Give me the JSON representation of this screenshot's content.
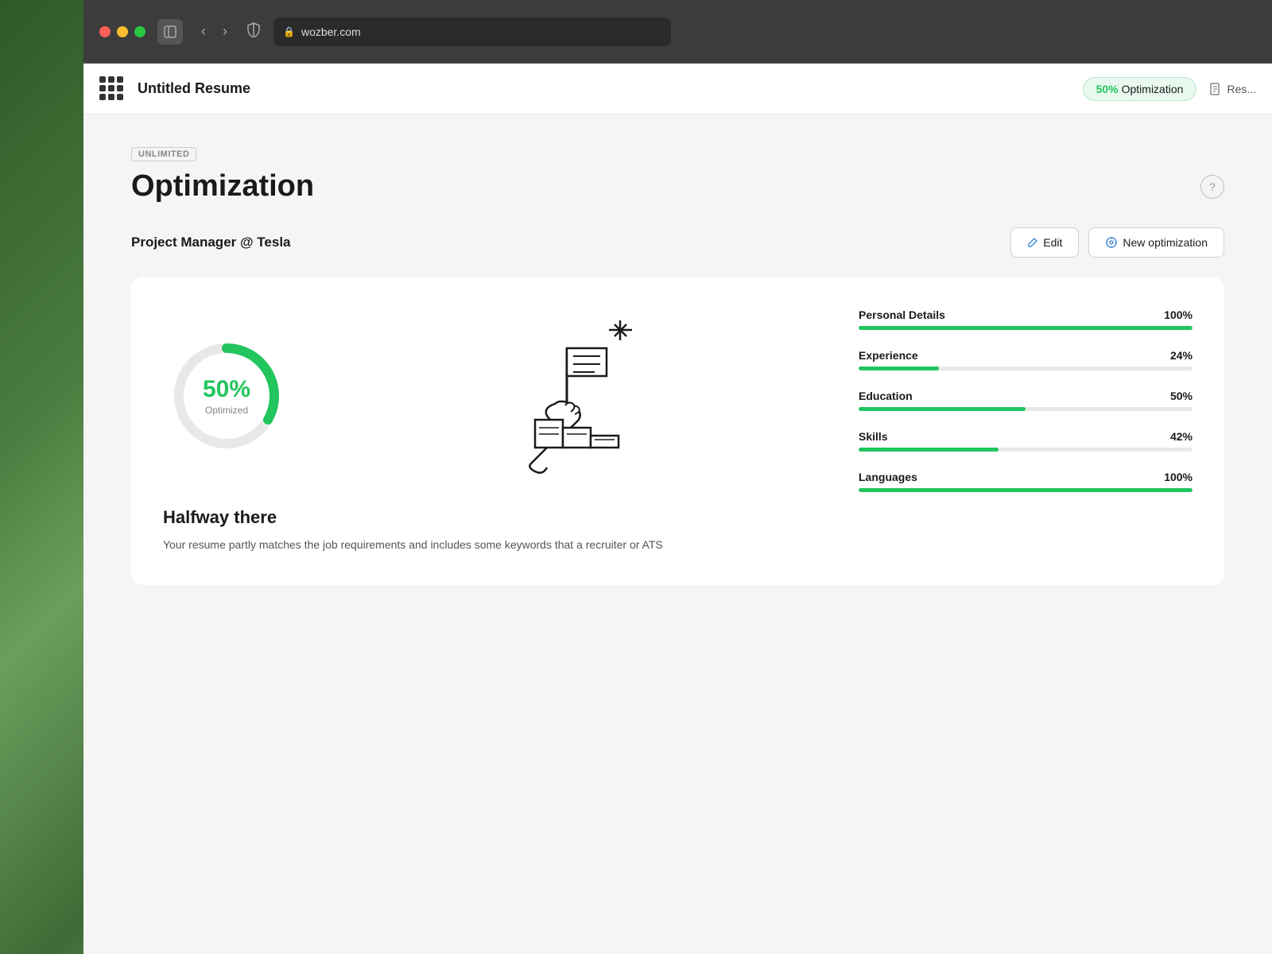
{
  "browser": {
    "url": "wozber.com",
    "tab_label": "Untitled Resume"
  },
  "nav": {
    "resume_title": "Untitled Resume",
    "optimization_badge": "50% Optimization",
    "optimization_pct": "50%",
    "optimization_label": "Optimization",
    "resume_link_label": "Res..."
  },
  "page": {
    "unlimited_badge": "UNLIMITED",
    "title": "Optimization",
    "help_icon": "?",
    "job_title": "Project Manager @ Tesla",
    "edit_btn": "Edit",
    "new_optimization_btn": "New optimization"
  },
  "card": {
    "donut_pct": "50%",
    "donut_label": "Optimized",
    "halfway_title": "Halfway there",
    "halfway_desc": "Your resume partly matches the job requirements and includes some keywords that a recruiter or ATS",
    "scores": [
      {
        "name": "Personal Details",
        "pct": "100%",
        "value": 100
      },
      {
        "name": "Experience",
        "pct": "24%",
        "value": 24
      },
      {
        "name": "Education",
        "pct": "50%",
        "value": 50
      },
      {
        "name": "Skills",
        "pct": "42%",
        "value": 42
      },
      {
        "name": "Languages",
        "pct": "100%",
        "value": 100
      }
    ]
  }
}
